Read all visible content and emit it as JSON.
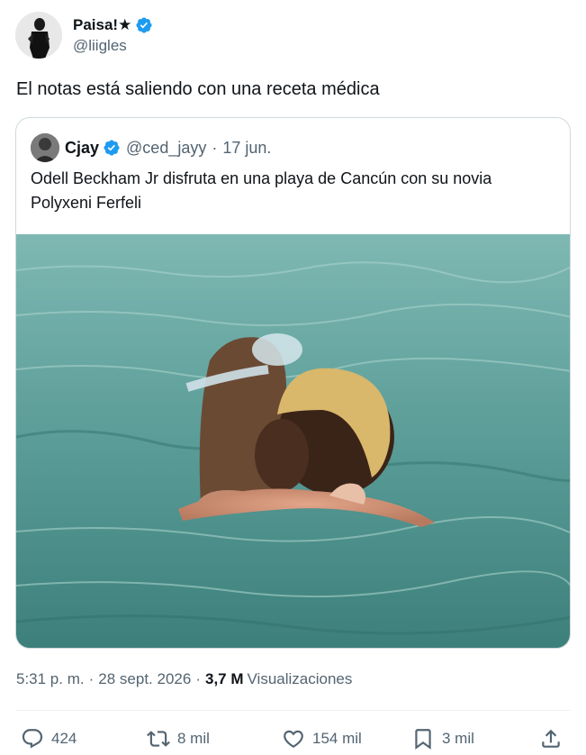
{
  "author": {
    "name": "Paisa!★",
    "handle": "@liigles"
  },
  "tweet": {
    "text": "El notas está saliendo con una receta médica",
    "time": "5:31 p. m.",
    "date": "28 sept. 2026",
    "views_count": "3,7 M",
    "views_label": "Visualizaciones"
  },
  "quoted": {
    "name": "Cjay",
    "handle": "@ced_jayy",
    "date": "17 jun.",
    "text": "Odell Beckham Jr disfruta en una playa de Cancún con su novia Polyxeni Ferfeli"
  },
  "actions": {
    "replies": "424",
    "retweets": "8 mil",
    "likes": "154 mil",
    "bookmarks": "3 mil"
  },
  "colors": {
    "verified": "#1d9bf0",
    "secondary_text": "#536471",
    "water": "#4f9a94"
  },
  "icons": [
    "verified-badge-icon",
    "reply-icon",
    "retweet-icon",
    "like-icon",
    "bookmark-icon",
    "share-icon"
  ]
}
